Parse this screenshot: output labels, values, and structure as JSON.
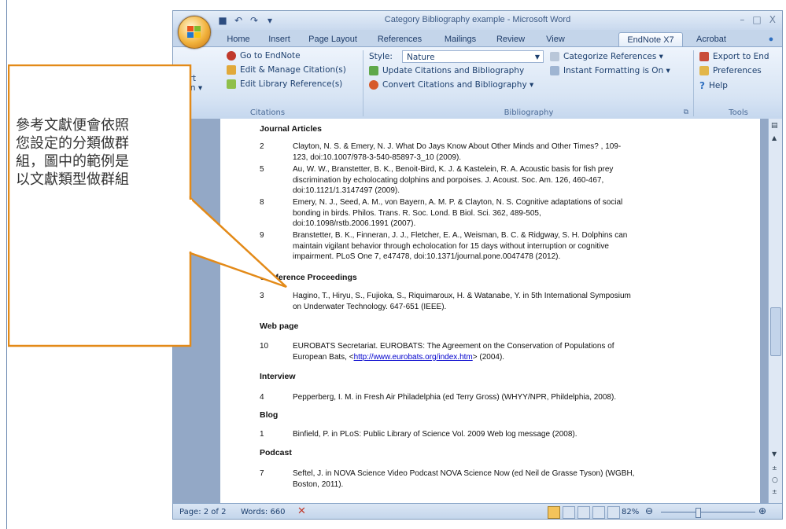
{
  "window": {
    "title": "Category Bibliography example - Microsoft Word",
    "controls": [
      "–",
      "□",
      "X"
    ]
  },
  "tabs": [
    "Home",
    "Insert",
    "Page Layout",
    "References",
    "Mailings",
    "Review",
    "View",
    "EndNote X7",
    "Acrobat"
  ],
  "active_tab": "EndNote X7",
  "ribbon": {
    "citations": {
      "insert_label_1": "nsert",
      "insert_label_2": "ation ▾",
      "go_to_endnote": "Go to EndNote",
      "edit_manage": "Edit & Manage Citation(s)",
      "edit_library": "Edit Library Reference(s)",
      "group_label": "Citations"
    },
    "bibliography": {
      "style_label": "Style:",
      "style_value": "Nature",
      "update": "Update Citations and Bibliography",
      "convert": "Convert Citations and Bibliography ▾",
      "categorize": "Categorize References ▾",
      "instant": "Instant Formatting is On ▾",
      "group_label": "Bibliography"
    },
    "tools": {
      "export": "Export to End",
      "preferences": "Preferences",
      "help": "Help",
      "group_label": "Tools"
    }
  },
  "document": {
    "sections": [
      {
        "heading": "Journal Articles",
        "refs": [
          {
            "n": "2",
            "lines": [
              "Clayton, N. S. & Emery, N. J. What Do Jays Know About Other Minds and Other Times? , 109-",
              "123, doi:10.1007/978-3-540-85897-3_10 (2009)."
            ]
          },
          {
            "n": "5",
            "lines": [
              "Au, W. W., Branstetter, B. K., Benoit-Bird, K. J. & Kastelein, R. A. Acoustic basis for fish prey",
              "discrimination by echolocating dolphins and porpoises. J. Acoust. Soc. Am. 126, 460-467,",
              "doi:10.1121/1.3147497 (2009)."
            ]
          },
          {
            "n": "8",
            "lines": [
              "Emery, N. J., Seed, A. M., von Bayern, A. M. P. & Clayton, N. S. Cognitive adaptations of social",
              "bonding in birds. Philos. Trans. R. Soc. Lond. B Biol. Sci. 362, 489-505,",
              "doi:10.1098/rstb.2006.1991 (2007)."
            ]
          },
          {
            "n": "9",
            "lines": [
              "Branstetter, B. K., Finneran, J. J., Fletcher, E. A., Weisman, B. C. & Ridgway, S. H. Dolphins can",
              "maintain vigilant behavior through echolocation for 15 days without interruption or cognitive",
              "impairment. PLoS One 7, e47478, doi:10.1371/journal.pone.0047478 (2012)."
            ]
          }
        ]
      },
      {
        "heading": "Conference Proceedings",
        "refs": [
          {
            "n": "3",
            "lines": [
              "Hagino, T., Hiryu, S., Fujioka, S., Riquimaroux, H. & Watanabe, Y. in 5th International Symposium",
              "on Underwater Technology. 647-651 (IEEE)."
            ]
          }
        ]
      },
      {
        "heading": "Web page",
        "refs": [
          {
            "n": "10",
            "lines": [
              "EUROBATS Secretariat. EUROBATS: The Agreement on the Conservation of Populations of",
              "European Bats, <http://www.eurobats.org/index.htm> (2004)."
            ]
          }
        ]
      },
      {
        "heading": "Interview",
        "refs": [
          {
            "n": "4",
            "lines": [
              "Pepperberg, I. M. in Fresh Air Philadelphia (ed Terry Gross) (WHYY/NPR, Phildelphia, 2008)."
            ]
          }
        ]
      },
      {
        "heading": "Blog",
        "refs": [
          {
            "n": "1",
            "lines": [
              "Binfield, P. in PLoS: Public Library of Science Vol. 2009 Web log message (2008)."
            ]
          }
        ]
      },
      {
        "heading": "Podcast",
        "refs": [
          {
            "n": "7",
            "lines": [
              "Seftel, J. in NOVA Science Video Podcast NOVA Science Now (ed Neil de Grasse Tyson) (WGBH,",
              "Boston, 2011)."
            ]
          }
        ]
      }
    ],
    "link_text": "http://www.eurobats.org/index.htm"
  },
  "status": {
    "page": "Page: 2 of 2",
    "words": "Words: 660",
    "zoom": "82%"
  },
  "callout": {
    "text": "參考文獻便會依照\n您設定的分類做群\n組，圖中的範例是\n以文獻類型做群組"
  },
  "colors": {
    "callout_border": "#e38a18",
    "ribbon_text": "#1c3f6e",
    "window_chrome": "#c4d5ea"
  }
}
